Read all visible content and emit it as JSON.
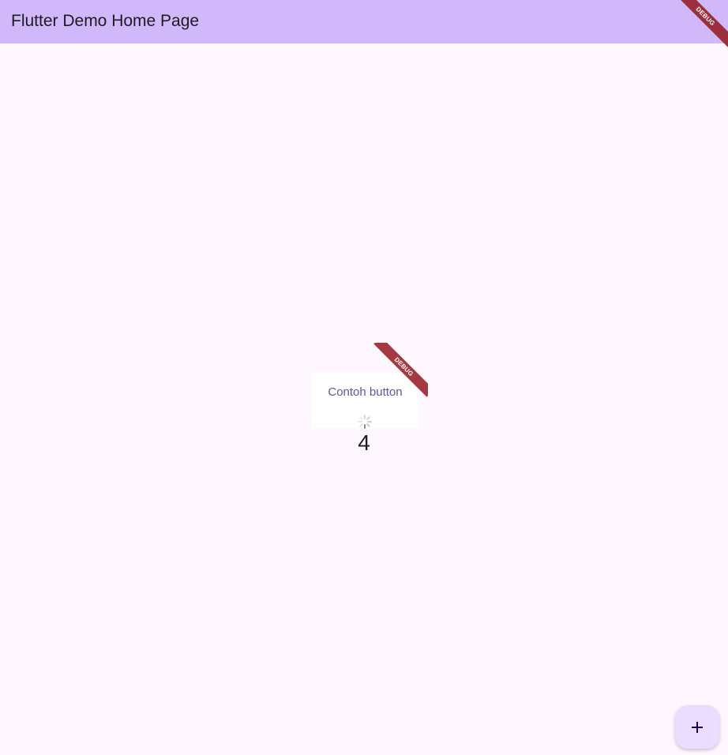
{
  "app_bar": {
    "title": "Flutter Demo Home Page",
    "background": "#d1b8fa",
    "debug_banner": "DEBUG"
  },
  "main": {
    "button_label": "Contoh button",
    "nested_debug_banner": "DEBUG",
    "loading_icon": "spinner-icon",
    "counter_value": "4",
    "background": "#fef7ff"
  },
  "fab": {
    "icon": "plus-icon",
    "background": "#eaddff"
  },
  "colors": {
    "primary_text": "#1d1b20",
    "button_text": "#65558f",
    "debug_red": "#9b2f3c"
  }
}
